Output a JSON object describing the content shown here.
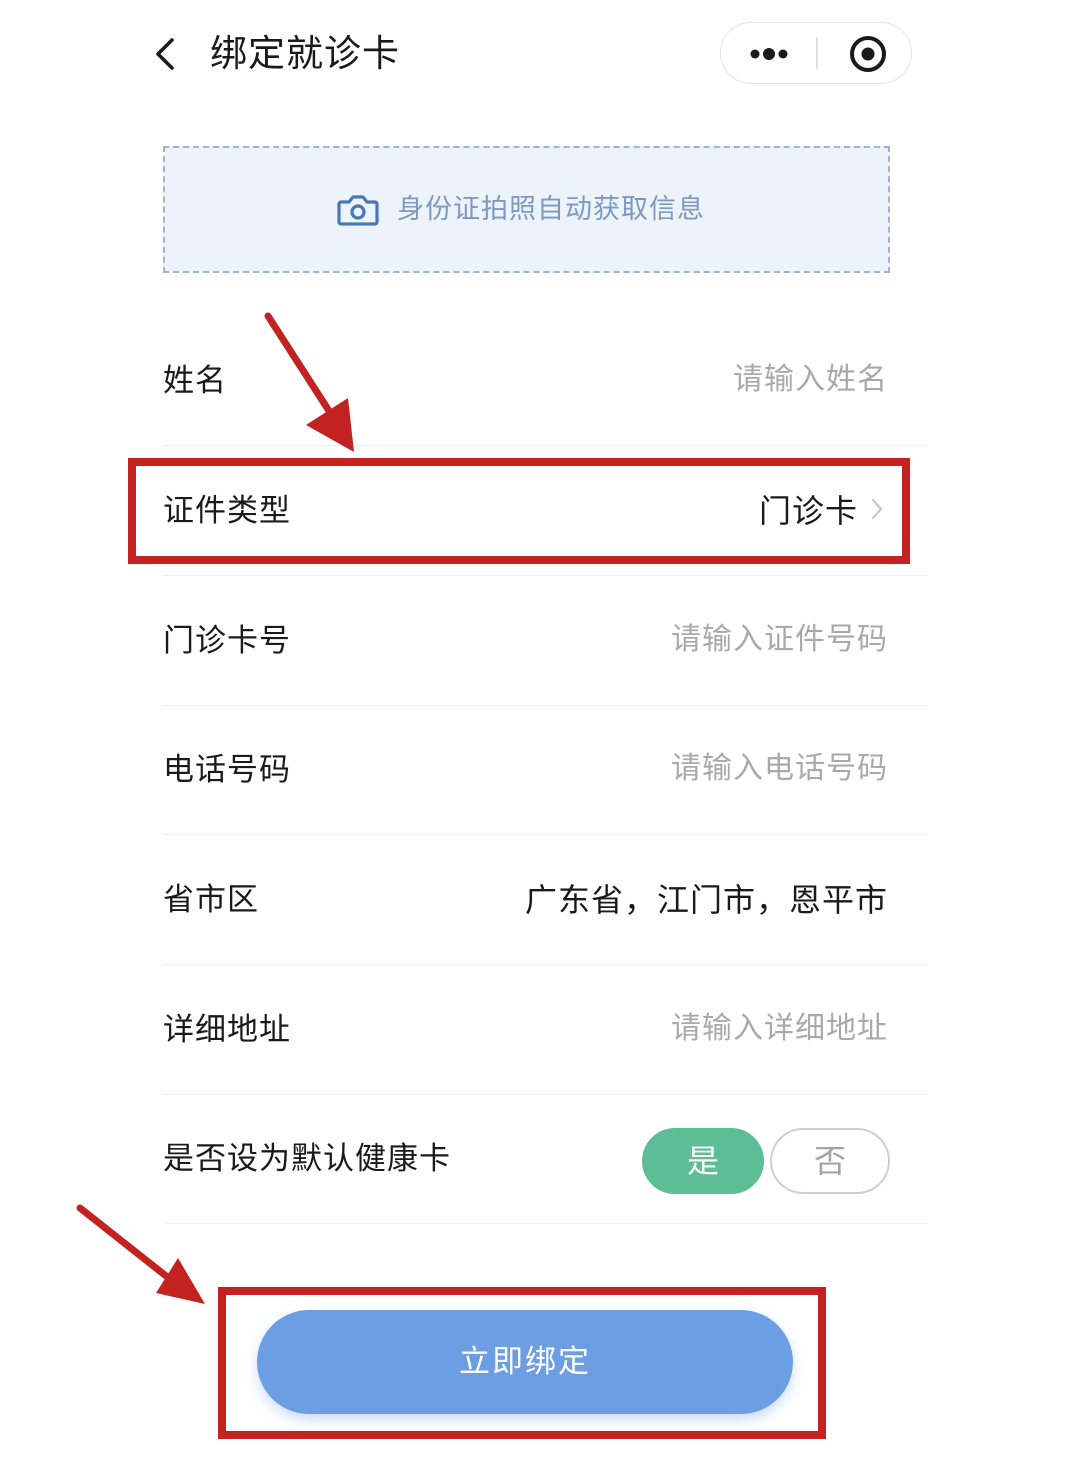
{
  "header": {
    "title": "绑定就诊卡",
    "back_icon": "chevron-left-icon",
    "more_icon": "more-dots-icon",
    "close_icon": "target-close-icon"
  },
  "photo_capture": {
    "label": "身份证拍照自动获取信息",
    "icon": "camera-icon"
  },
  "form": {
    "name": {
      "label": "姓名",
      "placeholder": "请输入姓名"
    },
    "id_type": {
      "label": "证件类型",
      "value": "门诊卡"
    },
    "card_number": {
      "label": "门诊卡号",
      "placeholder": "请输入证件号码"
    },
    "phone": {
      "label": "电话号码",
      "placeholder": "请输入电话号码"
    },
    "region": {
      "label": "省市区",
      "value": "广东省，江门市，恩平市"
    },
    "address": {
      "label": "详细地址",
      "placeholder": "请输入详细地址"
    },
    "default_card": {
      "label": "是否设为默认健康卡",
      "yes_label": "是",
      "no_label": "否",
      "selected": "是"
    }
  },
  "submit": {
    "label": "立即绑定"
  },
  "colors": {
    "accent_blue": "#6c9ee3",
    "toggle_green": "#5dbd94",
    "annotation_red": "#c42121",
    "photo_box_bg": "#edf3fb"
  }
}
